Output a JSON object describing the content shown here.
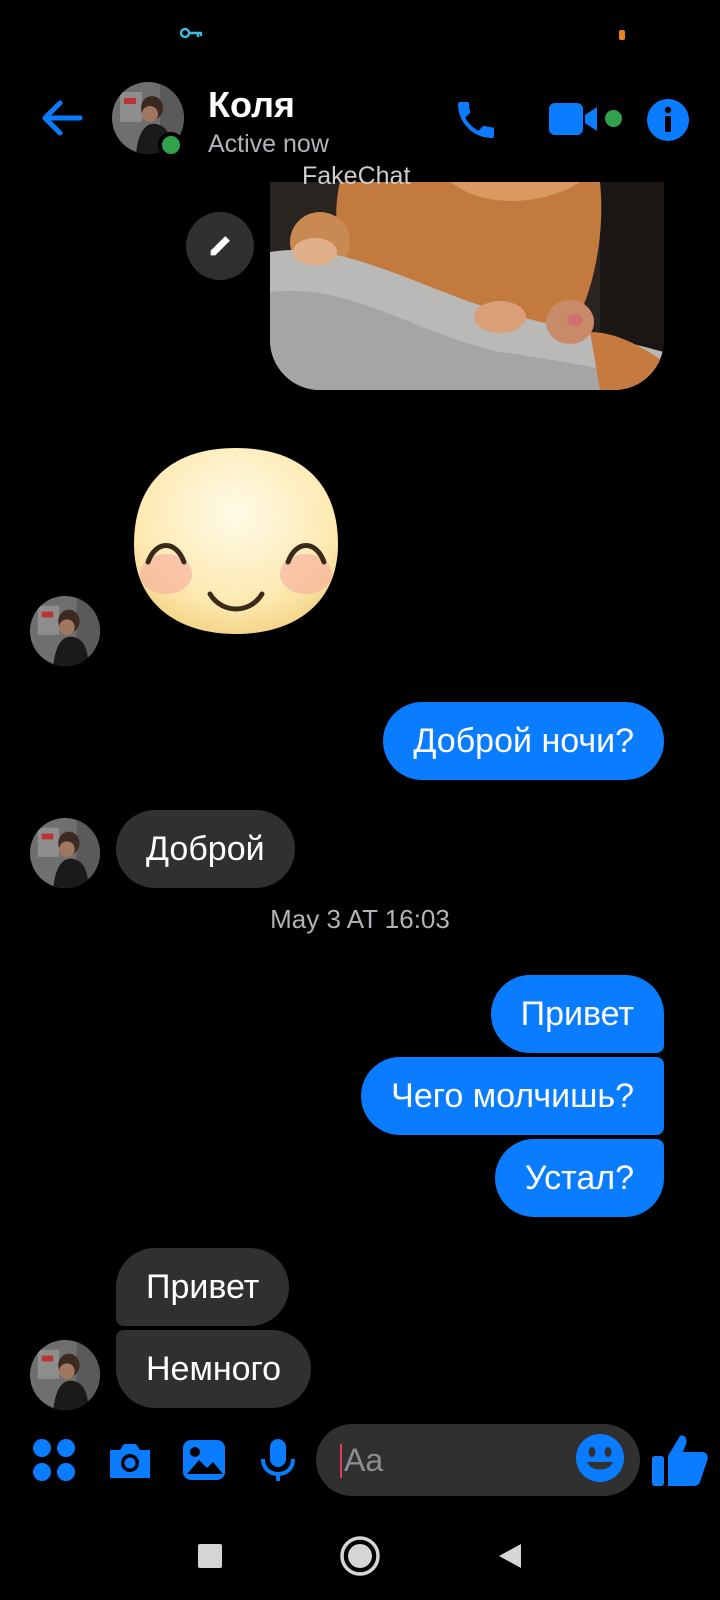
{
  "header": {
    "contact_name": "Коля",
    "contact_status": "Active now",
    "watermark": "FakeChat"
  },
  "messages": [
    {
      "direction": "out",
      "text": "Доброй ночи?"
    },
    {
      "direction": "in",
      "text": "Доброй"
    },
    {
      "direction": "out",
      "text": "Привет"
    },
    {
      "direction": "out",
      "text": "Чего молчишь?"
    },
    {
      "direction": "out",
      "text": "Устал?"
    },
    {
      "direction": "in",
      "text": "Привет"
    },
    {
      "direction": "in",
      "text": "Немного"
    }
  ],
  "timestamp": "May 3 AT 16:03",
  "composer": {
    "placeholder": "Aa"
  },
  "icons": {
    "back": "back-arrow-icon",
    "call": "phone-icon",
    "video": "video-camera-icon",
    "info": "info-icon",
    "edit": "pencil-icon",
    "apps": "four-dots-icon",
    "camera": "camera-icon",
    "gallery": "image-icon",
    "mic": "microphone-icon",
    "emoji": "smiley-icon",
    "like": "thumbs-up-icon"
  },
  "colors": {
    "accent": "#0a7cff",
    "online": "#31a24c",
    "incoming_bubble": "#303030",
    "background": "#000000"
  }
}
